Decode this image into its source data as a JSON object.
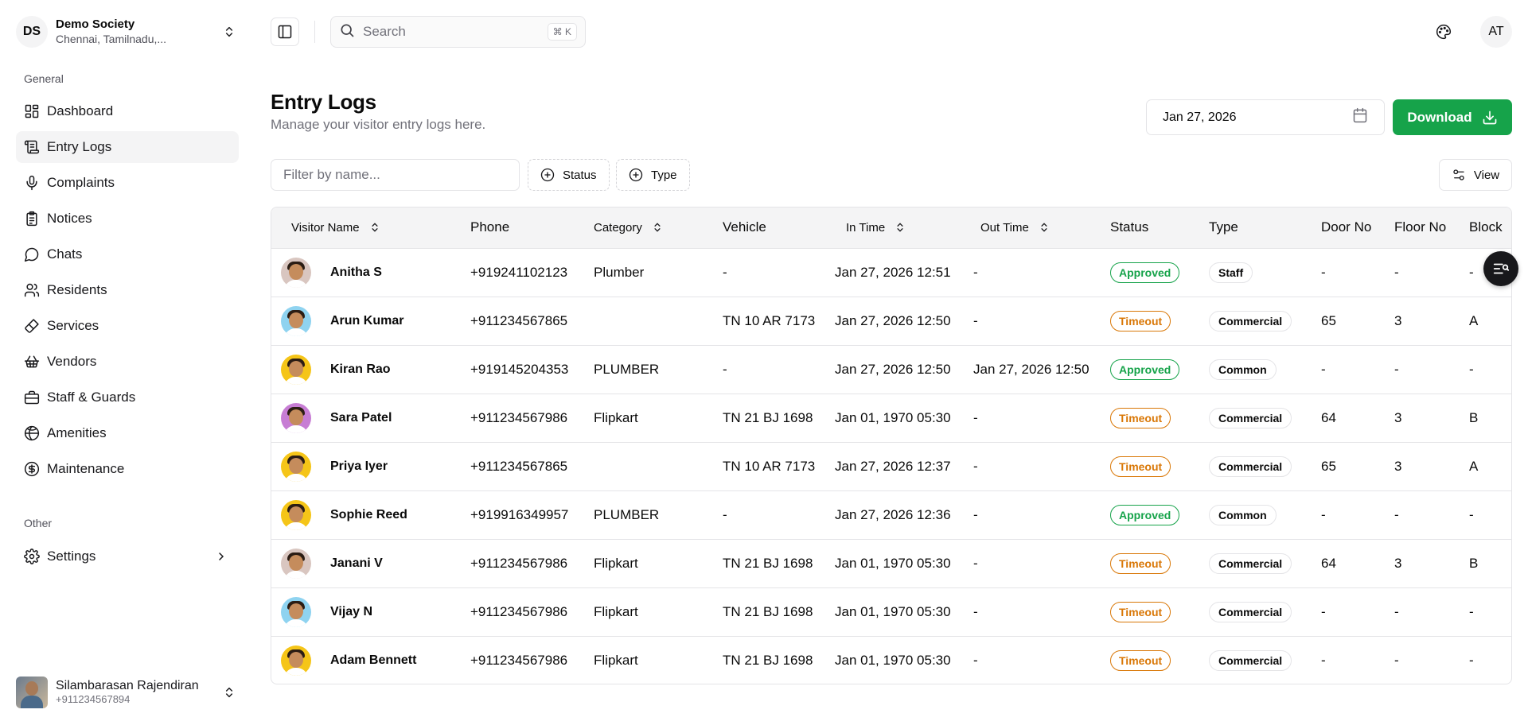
{
  "org": {
    "initials": "DS",
    "name": "Demo Society",
    "location": "Chennai, Tamilnadu,..."
  },
  "sidebar": {
    "general_label": "General",
    "items": [
      {
        "label": "Dashboard",
        "icon": "dashboard-icon"
      },
      {
        "label": "Entry Logs",
        "icon": "entry-logs-icon",
        "active": true
      },
      {
        "label": "Complaints",
        "icon": "microphone-icon"
      },
      {
        "label": "Notices",
        "icon": "clipboard-icon"
      },
      {
        "label": "Chats",
        "icon": "chat-icon"
      },
      {
        "label": "Residents",
        "icon": "users-icon"
      },
      {
        "label": "Services",
        "icon": "brush-icon"
      },
      {
        "label": "Vendors",
        "icon": "basket-icon"
      },
      {
        "label": "Staff & Guards",
        "icon": "briefcase-icon"
      },
      {
        "label": "Amenities",
        "icon": "amenities-icon"
      },
      {
        "label": "Maintenance",
        "icon": "dollar-icon"
      }
    ],
    "other_label": "Other",
    "settings_label": "Settings"
  },
  "user": {
    "name": "Silambarasan Rajendiran",
    "phone": "+911234567894"
  },
  "header": {
    "search_placeholder": "Search",
    "shortcut": "⌘ K",
    "avatar_initials": "AT"
  },
  "page": {
    "title": "Entry Logs",
    "subtitle": "Manage your visitor entry logs here.",
    "date": "Jan 27, 2026",
    "download_label": "Download"
  },
  "filters": {
    "name_placeholder": "Filter by name...",
    "status_label": "Status",
    "type_label": "Type",
    "view_label": "View"
  },
  "table": {
    "columns": [
      "Visitor Name",
      "Phone",
      "Category",
      "Vehicle",
      "In Time",
      "Out Time",
      "Status",
      "Type",
      "Door No",
      "Floor No",
      "Block"
    ],
    "rows": [
      {
        "name": "Anitha S",
        "phone": "+919241102123",
        "category": "Plumber",
        "vehicle": "-",
        "in_time": "Jan 27, 2026 12:51",
        "out_time": "-",
        "status": "Approved",
        "type": "Staff",
        "door": "-",
        "floor": "-",
        "block": "-"
      },
      {
        "name": "Arun Kumar",
        "phone": "+911234567865",
        "category": "",
        "vehicle": "TN 10 AR 7173",
        "in_time": "Jan 27, 2026 12:50",
        "out_time": "-",
        "status": "Timeout",
        "type": "Commercial",
        "door": "65",
        "floor": "3",
        "block": "A"
      },
      {
        "name": "Kiran Rao",
        "phone": "+919145204353",
        "category": "PLUMBER",
        "vehicle": "-",
        "in_time": "Jan 27, 2026 12:50",
        "out_time": "Jan 27, 2026 12:50",
        "status": "Approved",
        "type": "Common",
        "door": "-",
        "floor": "-",
        "block": "-"
      },
      {
        "name": "Sara Patel",
        "phone": "+911234567986",
        "category": "Flipkart",
        "vehicle": "TN 21 BJ 1698",
        "in_time": "Jan 01, 1970 05:30",
        "out_time": "-",
        "status": "Timeout",
        "type": "Commercial",
        "door": "64",
        "floor": "3",
        "block": "B"
      },
      {
        "name": "Priya Iyer",
        "phone": "+911234567865",
        "category": "",
        "vehicle": "TN 10 AR 7173",
        "in_time": "Jan 27, 2026 12:37",
        "out_time": "-",
        "status": "Timeout",
        "type": "Commercial",
        "door": "65",
        "floor": "3",
        "block": "A"
      },
      {
        "name": "Sophie Reed",
        "phone": "+919916349957",
        "category": "PLUMBER",
        "vehicle": "-",
        "in_time": "Jan 27, 2026 12:36",
        "out_time": "-",
        "status": "Approved",
        "type": "Common",
        "door": "-",
        "floor": "-",
        "block": "-"
      },
      {
        "name": "Janani V",
        "phone": "+911234567986",
        "category": "Flipkart",
        "vehicle": "TN 21 BJ 1698",
        "in_time": "Jan 01, 1970 05:30",
        "out_time": "-",
        "status": "Timeout",
        "type": "Commercial",
        "door": "64",
        "floor": "3",
        "block": "B"
      },
      {
        "name": "Vijay N",
        "phone": "+911234567986",
        "category": "Flipkart",
        "vehicle": "TN 21 BJ 1698",
        "in_time": "Jan 01, 1970 05:30",
        "out_time": "-",
        "status": "Timeout",
        "type": "Commercial",
        "door": "-",
        "floor": "-",
        "block": "-"
      },
      {
        "name": "Adam Bennett",
        "phone": "+911234567986",
        "category": "Flipkart",
        "vehicle": "TN 21 BJ 1698",
        "in_time": "Jan 01, 1970 05:30",
        "out_time": "-",
        "status": "Timeout",
        "type": "Commercial",
        "door": "-",
        "floor": "-",
        "block": "-"
      }
    ]
  },
  "avatar_colors": [
    "#d9c6c0",
    "#8fd3f0",
    "#f5c518",
    "#c77dd4",
    "#f5c518",
    "#f5c518",
    "#d9c6c0",
    "#8fd3f0",
    "#f5c518"
  ],
  "colors": {
    "accent": "#16a34a",
    "approved": "#16a34a",
    "timeout": "#d97706"
  }
}
